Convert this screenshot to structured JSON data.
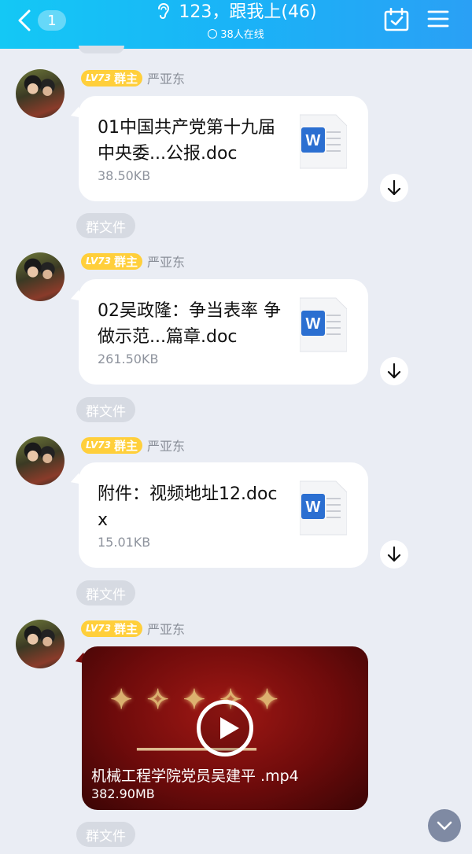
{
  "header": {
    "back_count": "1",
    "title": "123，跟我上(46)",
    "online": "38人在线"
  },
  "messages": [
    {
      "level": "LV73",
      "role": "群主",
      "sender": "严亚东",
      "file_name": "01中国共产党第十九届中央委...公报.doc",
      "file_size": "38.50KB",
      "tag": "群文件"
    },
    {
      "level": "LV73",
      "role": "群主",
      "sender": "严亚东",
      "file_name": "02吴政隆：争当表率 争做示范...篇章.doc",
      "file_size": "261.50KB",
      "tag": "群文件"
    },
    {
      "level": "LV73",
      "role": "群主",
      "sender": "严亚东",
      "file_name": "附件：视频地址12.docx",
      "file_size": "15.01KB",
      "tag": "群文件"
    },
    {
      "level": "LV73",
      "role": "群主",
      "sender": "严亚东",
      "video_name": "机械工程学院党员吴建平 .mp4",
      "video_size": "382.90MB",
      "tag": "群文件"
    }
  ],
  "colors": {
    "header_start": "#14c8f5",
    "header_end": "#2aa0f5",
    "badge": "#ffcf3b",
    "word_blue": "#2b6fd1"
  }
}
